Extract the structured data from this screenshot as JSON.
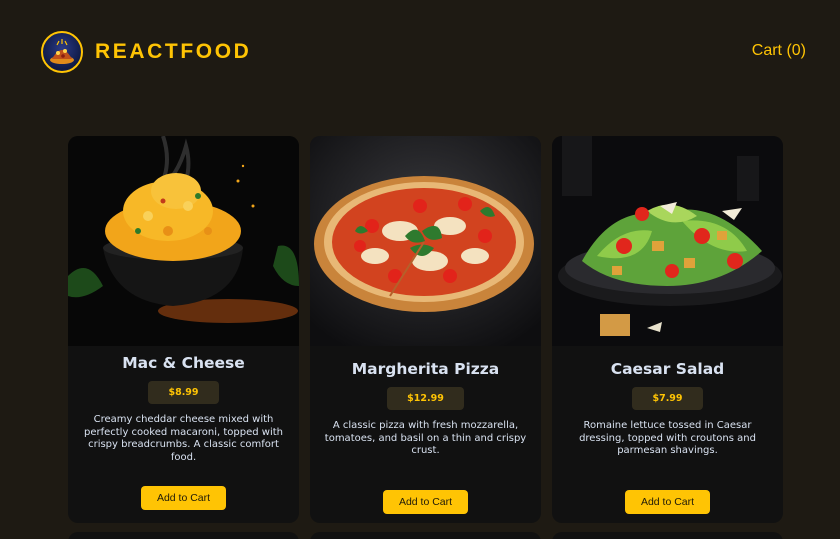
{
  "header": {
    "brand_title": "REACTFOOD",
    "cart_label": "Cart (0)"
  },
  "colors": {
    "accent": "#ffc404",
    "page_background": "#1e1a13",
    "card_background": "#111111",
    "price_background": "#312c1d",
    "text": "#d9e2f1"
  },
  "meals": [
    {
      "name": "Mac & Cheese",
      "price": "$8.99",
      "description": "Creamy cheddar cheese mixed with perfectly cooked macaroni, topped with crispy breadcrumbs. A classic comfort food.",
      "button_label": "Add to Cart",
      "image": "mac-and-cheese-photo"
    },
    {
      "name": "Margherita Pizza",
      "price": "$12.99",
      "description": "A classic pizza with fresh mozzarella, tomatoes, and basil on a thin and crispy crust.",
      "button_label": "Add to Cart",
      "image": "margherita-pizza-photo"
    },
    {
      "name": "Caesar Salad",
      "price": "$7.99",
      "description": "Romaine lettuce tossed in Caesar dressing, topped with croutons and parmesan shavings.",
      "button_label": "Add to Cart",
      "image": "caesar-salad-photo"
    }
  ]
}
